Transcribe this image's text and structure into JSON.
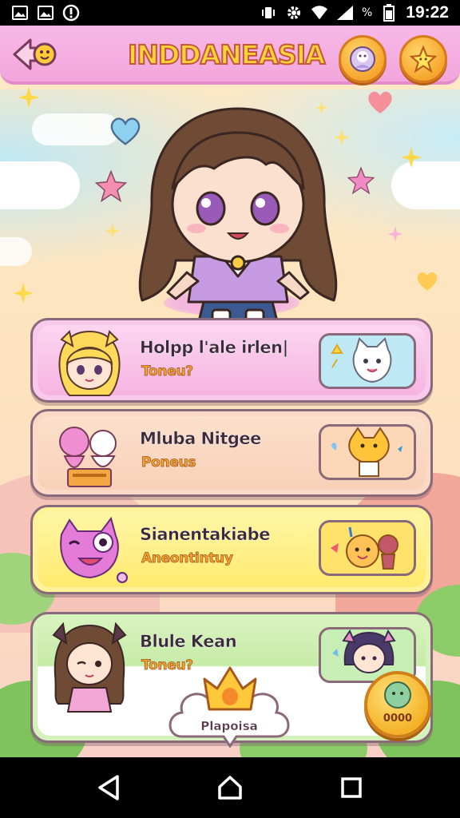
{
  "status_bar": {
    "time": "19:22",
    "icons": [
      "image-icon",
      "image-icon",
      "alert-icon",
      "vibrate-icon",
      "settings-icon",
      "wifi-icon",
      "signal-icon",
      "battery-icon"
    ],
    "battery_percent": "%"
  },
  "header": {
    "title": "INDDANEASIA",
    "back_icon": "back-arrow-icon",
    "buttons": [
      {
        "icon": "profile-icon"
      },
      {
        "icon": "star-icon"
      }
    ]
  },
  "cards": [
    {
      "name": "Holpp l'ale irlen|",
      "subtitle": "Toneu?",
      "color": "#f7b3e2",
      "badge_color": "#bfe8f5",
      "avatar": "blonde-girl-icon",
      "badge": "white-cat-icon"
    },
    {
      "name": "Mluba Nitgee",
      "subtitle": "Poneus",
      "color": "#f9d3bd",
      "badge_color": "#fbd7b7",
      "avatar": "pink-bunny-icon",
      "badge": "orange-cat-icon"
    },
    {
      "name": "Sianentakiabe",
      "subtitle": "Aneontintuy",
      "color": "#fff07e",
      "badge_color": "#ffe26c",
      "avatar": "purple-blob-icon",
      "badge": "orange-pet-icon"
    },
    {
      "name": "Blule Kean",
      "subtitle": "Toneu?",
      "color": "#c9ecae",
      "badge_color": "#c7eeb4",
      "avatar": "brown-hair-girl-icon",
      "badge": "purple-hair-girl-icon"
    }
  ],
  "play_button": {
    "label": "Plapoisa",
    "icon": "crown-icon"
  },
  "coin_button": {
    "label": "0000",
    "icon": "coin-icon"
  },
  "colors": {
    "header_pink": "#f5aee0",
    "title_yellow": "#ffd43a",
    "accent_orange": "#f6a62d"
  },
  "nav": {
    "back": "back-triangle-icon",
    "home": "home-icon",
    "recents": "recents-square-icon"
  }
}
